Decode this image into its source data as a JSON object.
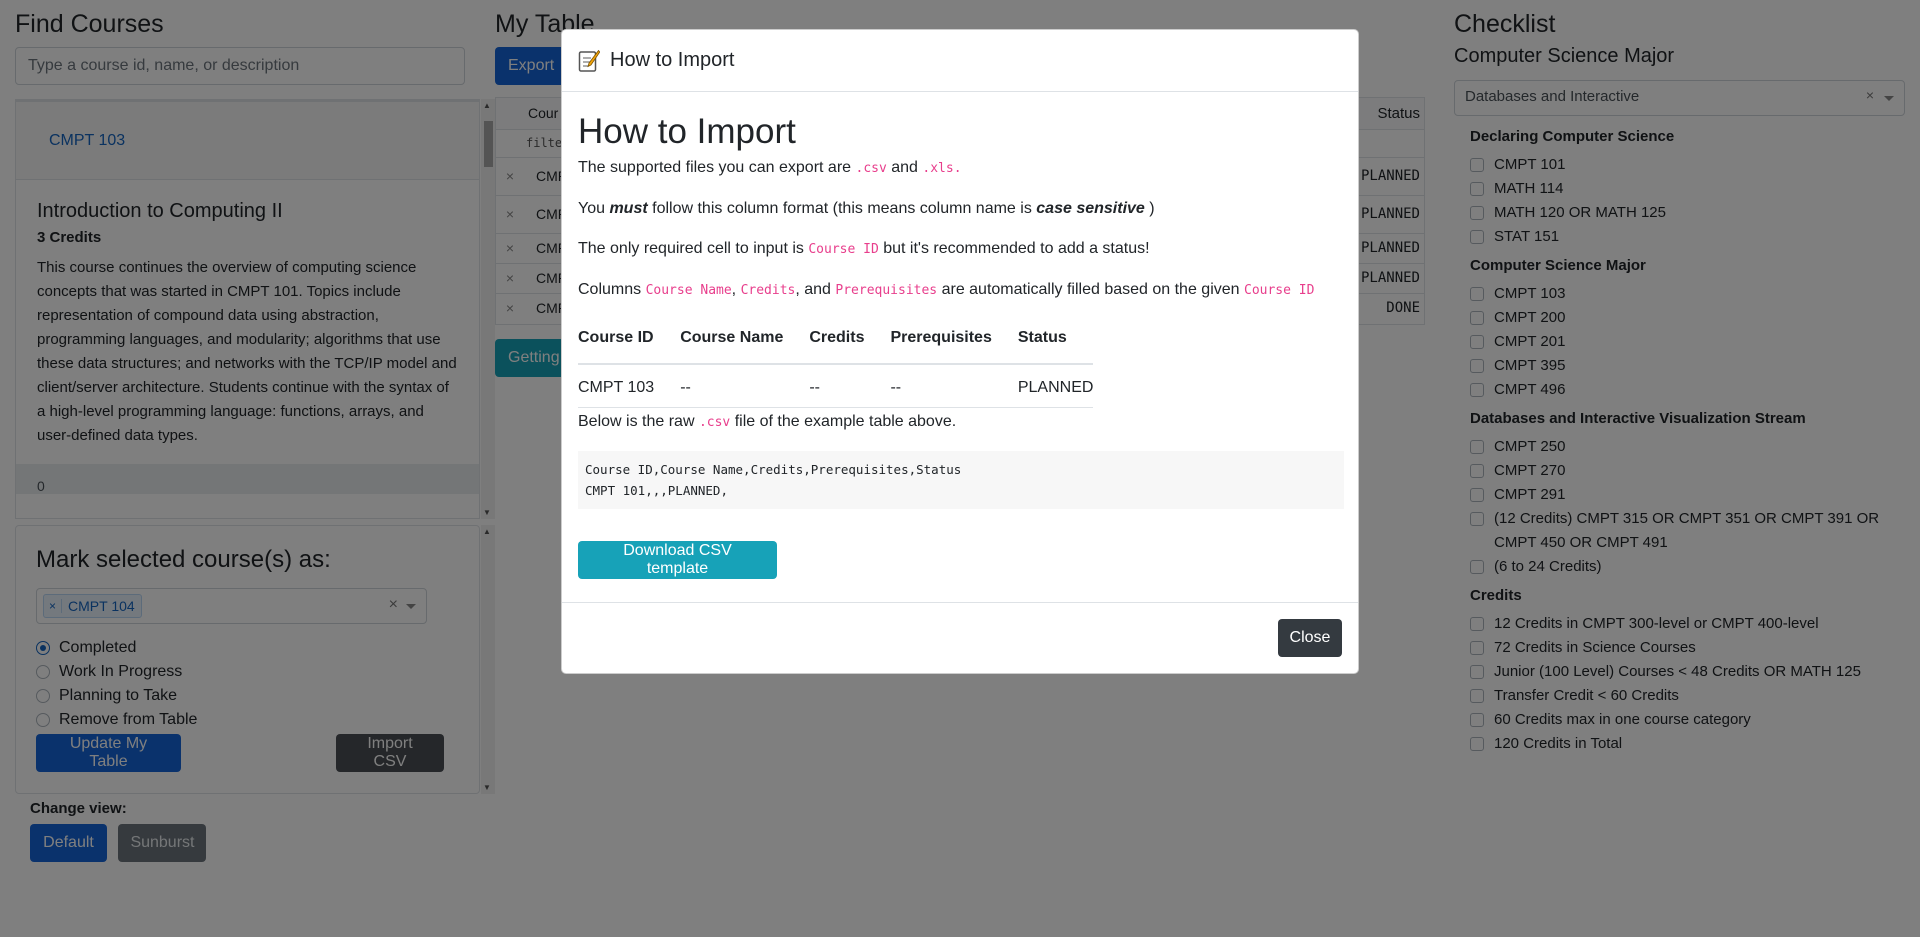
{
  "find_courses": {
    "title": "Find Courses",
    "search_placeholder": "Type a course id, name, or description",
    "course": {
      "id_link": "CMPT 103",
      "name": "Introduction to Computing II",
      "credits": "3 Credits",
      "description": "This course continues the overview of computing science concepts that was started in CMPT 101. Topics include representation of compound data using abstraction, programming languages, and modularity; algorithms that use these data structures; and networks with the TCP/IP model and client/server architecture. Students continue with the syntax of a high-level programming language: functions, arrays, and user-defined data types.",
      "footer_value": "0"
    }
  },
  "mark_selected": {
    "title": "Mark selected course(s) as:",
    "selected_tag": "CMPT 104",
    "options": [
      "Completed",
      "Work In Progress",
      "Planning to Take",
      "Remove from Table"
    ],
    "checked_option": "Completed",
    "update_button": "Update My Table",
    "import_button": "Import CSV"
  },
  "change_view": {
    "label": "Change view:",
    "default_button": "Default",
    "sunburst_button": "Sunburst"
  },
  "my_table": {
    "title": "My Table",
    "export_button": "Export",
    "header_course": "Cour",
    "header_status": "Status",
    "filter_text": "filte",
    "rows": [
      {
        "course": "CMP",
        "status": "PLANNED"
      },
      {
        "course": "CMP",
        "status": "PLANNED"
      },
      {
        "course": "CMP",
        "status": "PLANNED"
      },
      {
        "course": "CMP",
        "status": "PLANNED"
      },
      {
        "course": "CMP",
        "status": "DONE"
      }
    ],
    "getting_started_button": "Getting"
  },
  "checklist": {
    "title": "Checklist",
    "major": "Computer Science Major",
    "stream_selected": "Databases and Interactive",
    "groups": [
      {
        "title": "Declaring Computer Science",
        "items": [
          "CMPT 101",
          "MATH 114",
          "MATH 120 OR MATH 125",
          "STAT 151"
        ]
      },
      {
        "title": "Computer Science Major",
        "items": [
          "CMPT 103",
          "CMPT 200",
          "CMPT 201",
          "CMPT 395",
          "CMPT 496"
        ]
      },
      {
        "title": "Databases and Interactive Visualization Stream",
        "items": [
          "CMPT 250",
          "CMPT 270",
          "CMPT 291",
          "(12 Credits) CMPT 315 OR CMPT 351 OR CMPT 391 OR CMPT 450 OR CMPT 491",
          "(6 to 24 Credits)"
        ]
      },
      {
        "title": "Credits",
        "items": [
          "12 Credits in CMPT 300-level or CMPT 400-level",
          "72 Credits in Science Courses",
          "Junior (100 Level) Courses < 48 Credits OR MATH 125",
          "Transfer Credit < 60 Credits",
          "60 Credits max in one course category",
          "120 Credits in Total"
        ]
      }
    ]
  },
  "modal": {
    "header_title": "How to Import",
    "heading": "How to Import",
    "p1_text_a": "The supported files you can export are ",
    "p1_code_a": ".csv",
    "p1_text_b": " and ",
    "p1_code_b": ".xls.",
    "p2_text_a": "You ",
    "p2_emph": "must",
    "p2_text_b": " follow this column format (this means column name is ",
    "p2_emph2": "case sensitive",
    "p2_text_c": " )",
    "p3_text_a": "The only required cell to input is ",
    "p3_code": "Course ID",
    "p3_text_b": " but it's recommended to add a status!",
    "p4_text_a": "Columns ",
    "p4_code_a": "Course Name",
    "p4_sep1": ", ",
    "p4_code_b": "Credits",
    "p4_sep2": ", and ",
    "p4_code_c": "Prerequisites",
    "p4_text_b": " are automatically filled based on the given ",
    "p4_code_d": "Course ID",
    "table_headers": [
      "Course ID",
      "Course Name",
      "Credits",
      "Prerequisites",
      "Status"
    ],
    "table_row": [
      "CMPT 103",
      "--",
      "--",
      "--",
      "PLANNED"
    ],
    "raw_text_a": "Below is the raw ",
    "raw_code": ".csv",
    "raw_text_b": " file of the example table above.",
    "raw_lines": [
      "Course ID,Course Name,Credits,Prerequisites,Status",
      "CMPT 101,,,PLANNED,"
    ],
    "download_button": "Download CSV template",
    "close_button": "Close"
  }
}
